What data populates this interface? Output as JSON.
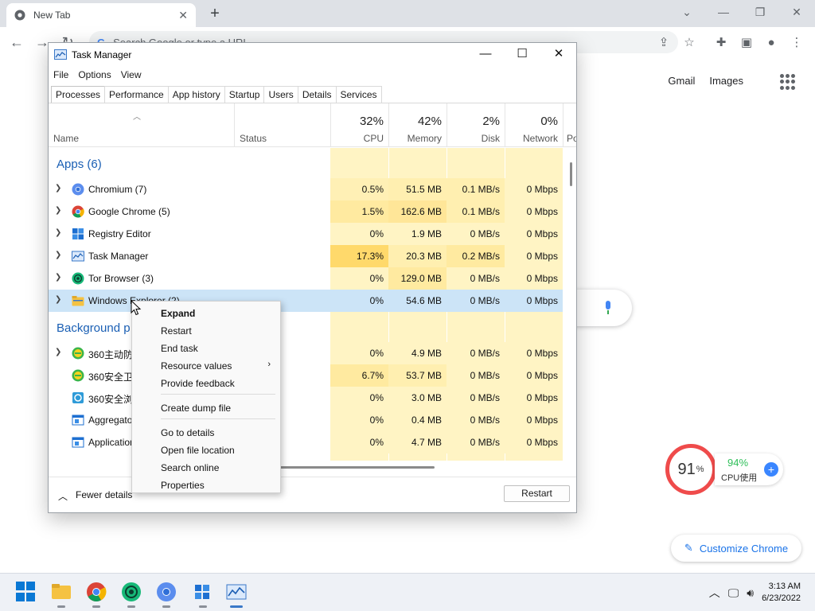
{
  "browser": {
    "tab_title": "New Tab",
    "tab_close": "✕",
    "new_tab": "+",
    "omnibox_placeholder": "Search Google or type a URL",
    "links": [
      "Gmail",
      "Images"
    ],
    "customize_label": "Customize Chrome"
  },
  "widget360": {
    "ring_value": "91",
    "ring_unit": "%",
    "cpu_value": "94%",
    "cpu_label": "CPU使用",
    "ring_color": "#ef4b4b",
    "value_color": "#2fbf5a"
  },
  "taskbar": {
    "time": "3:13 AM",
    "date": "6/23/2022"
  },
  "task_manager": {
    "title": "Task Manager",
    "menu": [
      "File",
      "Options",
      "View"
    ],
    "tabs": [
      "Processes",
      "Performance",
      "App history",
      "Startup",
      "Users",
      "Details",
      "Services"
    ],
    "active_tab": "Processes",
    "header": {
      "name": "Name",
      "status": "Status",
      "cpu_pct": "32%",
      "cpu": "CPU",
      "memory_pct": "42%",
      "memory": "Memory",
      "disk_pct": "2%",
      "disk": "Disk",
      "network_pct": "0%",
      "network": "Network",
      "power": "Po"
    },
    "apps_group": "Apps (6)",
    "background_group": "Background p",
    "apps": [
      {
        "name": "Chromium (7)",
        "cpu": "0.5%",
        "memory": "51.5 MB",
        "disk": "0.1 MB/s",
        "network": "0 Mbps",
        "icon": "chromium-icon"
      },
      {
        "name": "Google Chrome (5)",
        "cpu": "1.5%",
        "memory": "162.6 MB",
        "disk": "0.1 MB/s",
        "network": "0 Mbps",
        "icon": "chrome-icon"
      },
      {
        "name": "Registry Editor",
        "cpu": "0%",
        "memory": "1.9 MB",
        "disk": "0 MB/s",
        "network": "0 Mbps",
        "icon": "registry-icon"
      },
      {
        "name": "Task Manager",
        "cpu": "17.3%",
        "memory": "20.3 MB",
        "disk": "0.2 MB/s",
        "network": "0 Mbps",
        "icon": "taskmanager-icon"
      },
      {
        "name": "Tor Browser (3)",
        "cpu": "0%",
        "memory": "129.0 MB",
        "disk": "0 MB/s",
        "network": "0 Mbps",
        "icon": "tor-icon"
      },
      {
        "name": "Windows Explorer (2)",
        "cpu": "0%",
        "memory": "54.6 MB",
        "disk": "0 MB/s",
        "network": "0 Mbps",
        "icon": "folder-icon"
      }
    ],
    "background": [
      {
        "name": "360主动防",
        "cpu": "0%",
        "memory": "4.9 MB",
        "disk": "0 MB/s",
        "network": "0 Mbps",
        "expandable": true
      },
      {
        "name": "360安全卫",
        "cpu": "6.7%",
        "memory": "53.7 MB",
        "disk": "0 MB/s",
        "network": "0 Mbps",
        "expandable": false
      },
      {
        "name": "360安全浏",
        "cpu": "0%",
        "memory": "3.0 MB",
        "disk": "0 MB/s",
        "network": "0 Mbps",
        "expandable": false
      },
      {
        "name": "Aggregato",
        "cpu": "0%",
        "memory": "0.4 MB",
        "disk": "0 MB/s",
        "network": "0 Mbps",
        "expandable": false
      },
      {
        "name": "Application",
        "cpu": "0%",
        "memory": "4.7 MB",
        "disk": "0 MB/s",
        "network": "0 Mbps",
        "expandable": false
      }
    ],
    "fewer_details": "Fewer details",
    "restart_button": "Restart"
  },
  "context_menu": {
    "items": [
      "Expand",
      "Restart",
      "End task",
      "Resource values",
      "Provide feedback",
      "Create dump file",
      "Go to details",
      "Open file location",
      "Search online",
      "Properties"
    ]
  }
}
